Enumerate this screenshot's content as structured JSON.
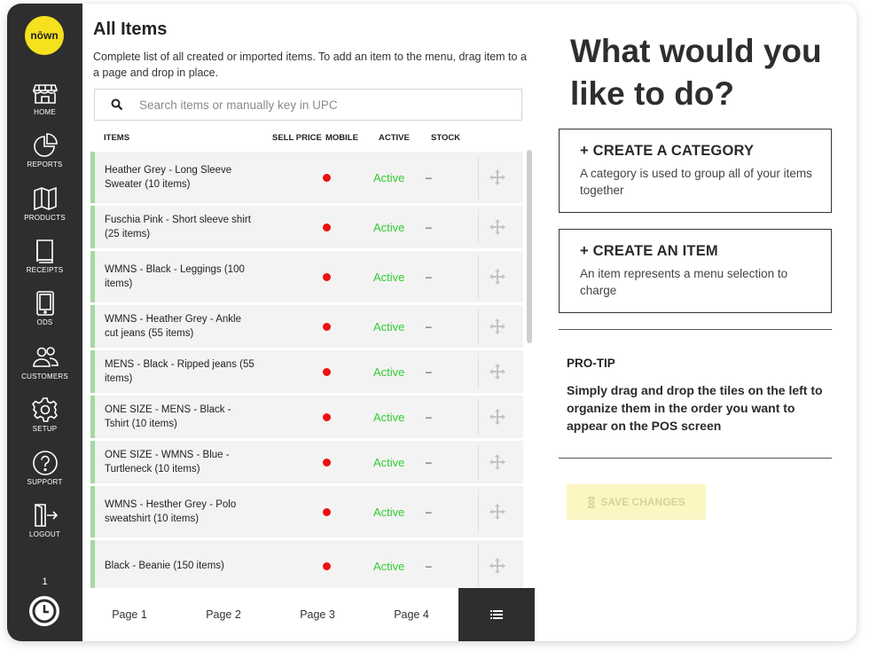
{
  "brand": {
    "logo_text": "nōwn",
    "color": "#f5e11e"
  },
  "sidebar": {
    "items": [
      {
        "label": "HOME",
        "icon": "store-icon"
      },
      {
        "label": "REPORTS",
        "icon": "pie-chart-icon"
      },
      {
        "label": "PRODUCTS",
        "icon": "map-icon"
      },
      {
        "label": "RECEIPTS",
        "icon": "book-icon"
      },
      {
        "label": "ODS",
        "icon": "tablet-icon"
      },
      {
        "label": "CUSTOMERS",
        "icon": "users-icon"
      },
      {
        "label": "SETUP",
        "icon": "gear-icon"
      },
      {
        "label": "SUPPORT",
        "icon": "help-icon"
      },
      {
        "label": "LOGOUT",
        "icon": "logout-icon"
      }
    ],
    "count": "1",
    "clock_icon": "clock-icon"
  },
  "items_panel": {
    "title": "All Items",
    "description": "Complete list of all created or imported items. To add an item to the menu, drag item to a a page and drop in place.",
    "search_placeholder": "Search items or manually key in UPC",
    "columns": [
      "ITEMS",
      "SELL PRICE",
      "MOBILE",
      "ACTIVE",
      "STOCK"
    ],
    "rows": [
      {
        "name": "Heather Grey - Long Sleeve Sweater (10 items)",
        "status": "Active",
        "stock": "–"
      },
      {
        "name": "Fuschia Pink - Short sleeve shirt (25 items)",
        "status": "Active",
        "stock": "–"
      },
      {
        "name": "WMNS - Black - Leggings (100 items)",
        "status": "Active",
        "stock": "–"
      },
      {
        "name": "WMNS - Heather Grey - Ankle cut jeans (55 items)",
        "status": "Active",
        "stock": "–"
      },
      {
        "name": "MENS - Black - Ripped jeans (55 items)",
        "status": "Active",
        "stock": "–"
      },
      {
        "name": "ONE SIZE - MENS - Black - Tshirt (10 items)",
        "status": "Active",
        "stock": "–"
      },
      {
        "name": "ONE SIZE - WMNS - Blue - Turtleneck (10 items)",
        "status": "Active",
        "stock": "–"
      },
      {
        "name": "WMNS - Hesther Grey - Polo sweatshirt (10 items)",
        "status": "Active",
        "stock": "–"
      },
      {
        "name": "Black - Beanie (150 items)",
        "status": "Active",
        "stock": "–"
      }
    ],
    "pages": [
      "Page 1",
      "Page 2",
      "Page 3",
      "Page 4"
    ],
    "colors": {
      "active": "#33cc33",
      "mobile_dot": "#ee1111",
      "row_bar": "#a5d9a3"
    }
  },
  "actions": {
    "headline": "What would you like to do?",
    "create_category": {
      "title": "CREATE A CATEGORY",
      "desc": "A category is used to group all of your items together"
    },
    "create_item": {
      "title": "CREATE AN ITEM",
      "desc": "An item represents a menu selection to charge"
    },
    "protip_title": "PRO-TIP",
    "protip_body": "Simply drag and drop the tiles on the left to organize them in the order you want to appear on the POS screen",
    "save_label": "SAVE CHANGES"
  }
}
